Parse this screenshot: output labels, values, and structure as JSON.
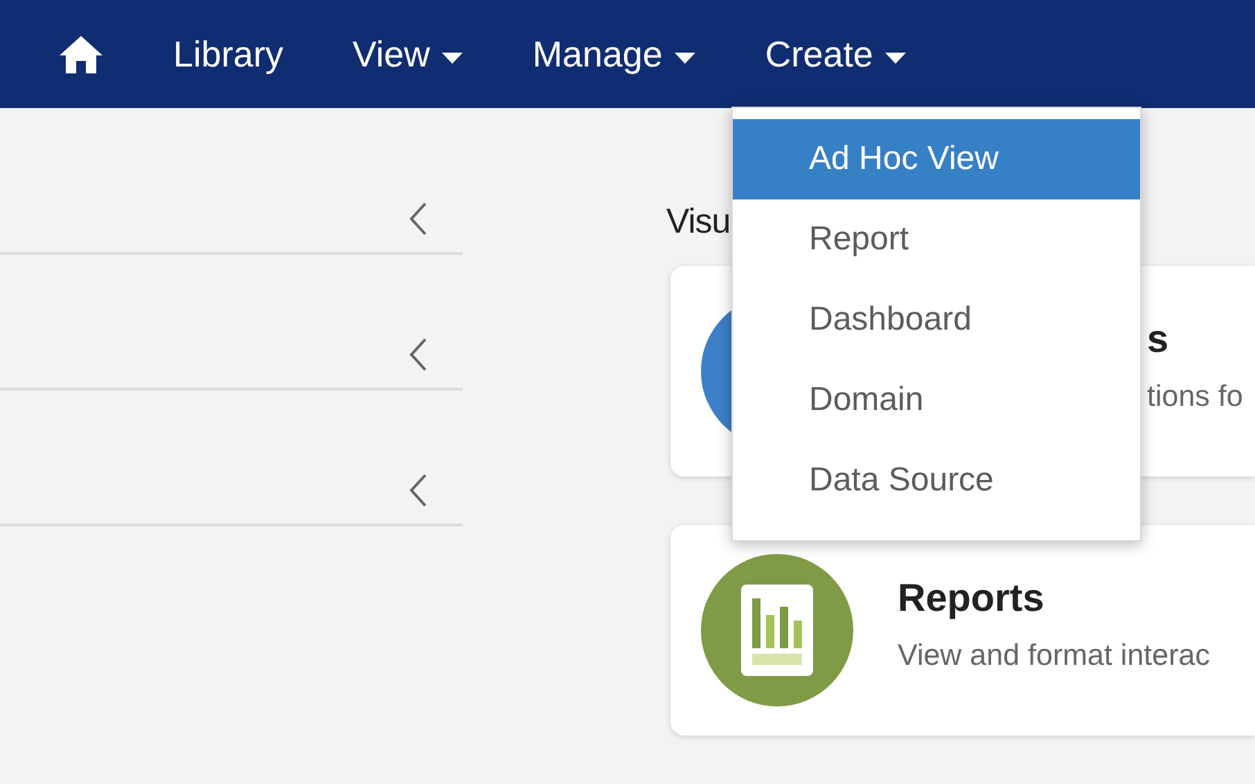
{
  "navbar": {
    "items": [
      {
        "kind": "home"
      },
      {
        "kind": "link",
        "label": "Library"
      },
      {
        "kind": "dropdown",
        "label": "View",
        "expanded": false
      },
      {
        "kind": "dropdown",
        "label": "Manage",
        "expanded": false
      },
      {
        "kind": "dropdown",
        "label": "Create",
        "expanded": true
      }
    ]
  },
  "create_menu": {
    "items": [
      {
        "label": "Ad Hoc View",
        "selected": true
      },
      {
        "label": "Report",
        "selected": false
      },
      {
        "label": "Dashboard",
        "selected": false
      },
      {
        "label": "Domain",
        "selected": false
      },
      {
        "label": "Data Source",
        "selected": false
      }
    ]
  },
  "sidebar": {
    "rows": [
      {
        "expanded": false
      },
      {
        "expanded": false
      },
      {
        "expanded": false
      }
    ]
  },
  "section": {
    "title": "Visu"
  },
  "cards": [
    {
      "kind": "plain",
      "color": "#3d80c8",
      "title": "s",
      "description": "tions fo"
    },
    {
      "kind": "report",
      "color": "#7f9b45",
      "title": "Reports",
      "description": "View and format interac"
    }
  ]
}
